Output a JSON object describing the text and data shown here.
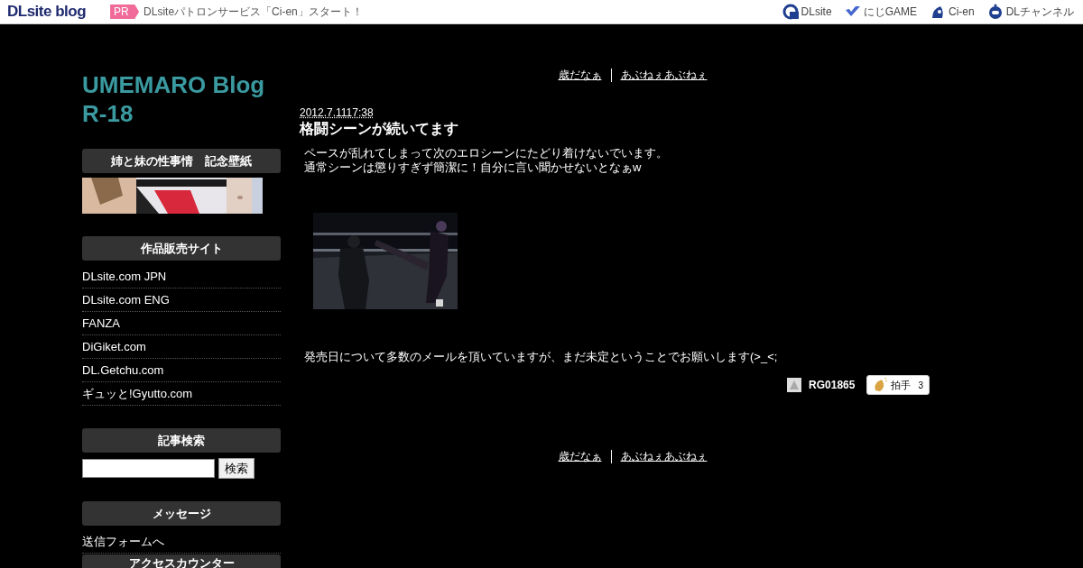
{
  "topbar": {
    "logo": "DLsite blog",
    "pr_badge": "PR",
    "pr_text": "DLsiteパトロンサービス「Ci-en」スタート！",
    "links": [
      {
        "label": "DLsite",
        "kind": "dlsite"
      },
      {
        "label": "にじGAME",
        "kind": "niji"
      },
      {
        "label": "Ci-en",
        "kind": "cien"
      },
      {
        "label": "DLチャンネル",
        "kind": "channel"
      }
    ]
  },
  "blog_title": "UMEMARO Blog R-18",
  "sidebar": [
    {
      "heading": "姉と妹の性事情　記念壁紙",
      "kind": "banner"
    },
    {
      "heading": "作品販売サイト",
      "kind": "links",
      "items": [
        "DLsite.com JPN",
        "DLsite.com ENG",
        "FANZA",
        "DiGiket.com",
        "DL.Getchu.com",
        "ギュッと!Gyutto.com"
      ]
    },
    {
      "heading": "記事検索",
      "kind": "search",
      "button": "検索"
    },
    {
      "heading": "メッセージ",
      "kind": "links",
      "items": [
        "送信フォームへ"
      ]
    },
    {
      "heading": "アクセスカウンター",
      "kind": "heading"
    }
  ],
  "nav_top": {
    "prev": "歳だなぁ",
    "next": "あぶねぇあぶねぇ"
  },
  "post": {
    "date": "2012.7.1117:38",
    "title": "格闘シーンが続いてます",
    "lines": [
      "ペースが乱れてしまって次のエロシーンにたどり着けないでいます。",
      "通常シーンは懲りすぎず簡潔に！自分に言い聞かせないとなぁw"
    ],
    "closing": "発売日について多数のメールを頂いていますが、まだ未定ということでお願いします(>_<;",
    "author": "RG01865",
    "clap_label": "拍手",
    "clap_count": "3"
  },
  "nav_bottom": {
    "prev": "歳だなぁ",
    "next": "あぶねぇあぶねぇ"
  }
}
